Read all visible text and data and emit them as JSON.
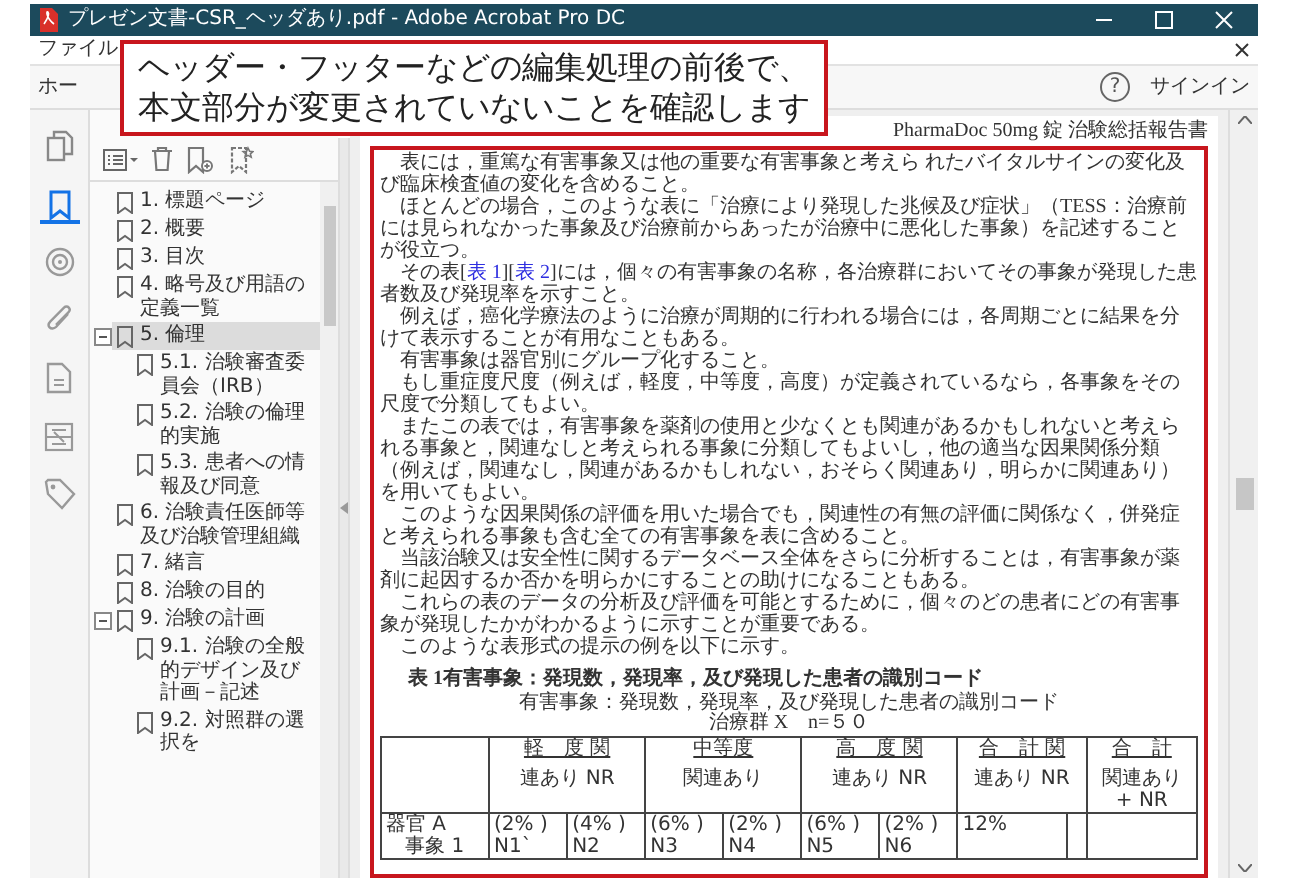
{
  "window": {
    "title": "プレゼン文書-CSR_ヘッダあり.pdf - Adobe Acrobat Pro DC"
  },
  "menu_bar": {
    "items": [
      "ファイル"
    ]
  },
  "toolbar": {
    "tab": "ホー",
    "help": "?",
    "sign_in": "サインイン"
  },
  "callout": {
    "lines": [
      "ヘッダー・フッターなどの編集処理の前後で、",
      "本文部分が変更されていないことを確認します"
    ]
  },
  "left_rail": {
    "items": [
      {
        "kind": "copy",
        "selected": false
      },
      {
        "kind": "bookmark",
        "selected": true
      },
      {
        "kind": "layers",
        "selected": false
      },
      {
        "kind": "attach",
        "selected": false
      },
      {
        "kind": "page",
        "selected": false
      },
      {
        "kind": "compare",
        "selected": false
      },
      {
        "kind": "tag",
        "selected": false
      }
    ]
  },
  "bookmarks": {
    "items": [
      {
        "label": "1. 標題ページ",
        "selected": false
      },
      {
        "label": "2. 概要",
        "selected": false
      },
      {
        "label": "3. 目次",
        "selected": false
      },
      {
        "label": "4. 略号及び用語の定義一覧",
        "selected": false
      },
      {
        "label": "5. 倫理",
        "selected": true,
        "expanded": true,
        "children": [
          {
            "label": "5.1. 治験審査委員会（IRB）",
            "selected": false
          },
          {
            "label": "5.2. 治験の倫理的実施",
            "selected": false
          },
          {
            "label": "5.3. 患者への情報及び同意",
            "selected": false
          }
        ]
      },
      {
        "label": "6. 治験責任医師等及び治験管理組織",
        "selected": false
      },
      {
        "label": "7. 緒言",
        "selected": false
      },
      {
        "label": "8. 治験の目的",
        "selected": false
      },
      {
        "label": "9. 治験の計画",
        "selected": false,
        "expanded": true,
        "children": [
          {
            "label": "9.1. 治験の全般的デザイン及び計画－記述",
            "selected": false
          },
          {
            "label": "9.2. 対照群の選択を",
            "selected": false
          }
        ]
      }
    ]
  },
  "document": {
    "header": "PharmaDoc 50mg 錠  治験総括報告書",
    "paragraphs": [
      [
        {
          "kind": "text",
          "text": "表には，重篤な有害事象又は他の重要な有害事象と考えら れたバイタルサインの変化及び臨床検査値の変化を含めること。"
        }
      ],
      [
        {
          "kind": "text",
          "text": "ほとんどの場合，このような表に「治療により発現した兆候及び症状」（TESS：治療前には見られなかった事象及び治療前からあったが治療中に悪化した事象）を記述することが役立つ。"
        }
      ],
      [
        {
          "kind": "text",
          "text": "その表["
        },
        {
          "kind": "link",
          "text": "表 1"
        },
        {
          "kind": "text",
          "text": "]["
        },
        {
          "kind": "link",
          "text": "表 2"
        },
        {
          "kind": "text",
          "text": "]には，個々の有害事象の名称，各治療群においてその事象が発現した患者数及び発現率を示すこと。"
        }
      ],
      [
        {
          "kind": "text",
          "text": "例えば，癌化学療法のように治療が周期的に行われる場合には，各周期ごとに結果を分けて表示することが有用なこともある。"
        }
      ],
      [
        {
          "kind": "text",
          "text": "有害事象は器官別にグループ化すること。"
        }
      ],
      [
        {
          "kind": "text",
          "text": "もし重症度尺度（例えば，軽度，中等度，高度）が定義されているなら，各事象をその尺度で分類してもよい。"
        }
      ],
      [
        {
          "kind": "text",
          "text": "またこの表では，有害事象を薬剤の使用と少なくとも関連があるかもしれないと考えられる事象と，関連なしと考えられる事象に分類してもよいし，他の適当な因果関係分類（例えば，関連なし，関連があるかもしれない，おそらく関連あり，明らかに関連あり）を用いてもよい。"
        }
      ],
      [
        {
          "kind": "text",
          "text": "このような因果関係の評価を用いた場合でも，関連性の有無の評価に関係なく，併発症と考えられる事象も含む全ての有害事象を表に含めること。"
        }
      ],
      [
        {
          "kind": "text",
          "text": "当該治験又は安全性に関するデータベース全体をさらに分析することは，有害事象が薬剤に起因するか否かを明らかにすることの助けになることもある。"
        }
      ],
      [
        {
          "kind": "text",
          "text": "これらの表のデータの分析及び評価を可能とするために，個々のどの患者にどの有害事象が発現したかがわかるように示すことが重要である。"
        }
      ],
      [
        {
          "kind": "text",
          "text": "このような表形式の提示の例を以下に示す。"
        }
      ]
    ],
    "table_title": "表 1有害事象：発現数，発現率，及び発現した患者の識別コード",
    "table_caption": "有害事象：発現数，発現率，及び発現した患者の識別コード",
    "group_label": "治療群 X　n=５０",
    "table": {
      "columns": [
        {
          "colspan": 2,
          "label": "軽　度 関",
          "sub": [
            "連あり NR"
          ]
        },
        {
          "colspan": 2,
          "label": "中等度",
          "sub": [
            "関連あり"
          ]
        },
        {
          "colspan": 2,
          "label": "高　度 関",
          "sub": [
            "連あり NR"
          ]
        },
        {
          "colspan": 2,
          "label": "合　計 関",
          "sub": [
            "連あり NR"
          ]
        },
        {
          "label": "合　計",
          "sub": [
            "関連あり",
            "+ NR"
          ]
        }
      ],
      "rows": [
        {
          "label": [
            "器官 A",
            "事象 1"
          ],
          "cells": [
            [
              "(2% )",
              "N1`"
            ],
            [
              "(4% )",
              "N2"
            ],
            [
              "(6% )",
              "N3"
            ],
            [
              "(2% )",
              "N4"
            ],
            [
              "(6% )",
              "N5"
            ],
            [
              "(2% )",
              "N6"
            ],
            [
              "12%"
            ]
          ]
        }
      ]
    }
  }
}
